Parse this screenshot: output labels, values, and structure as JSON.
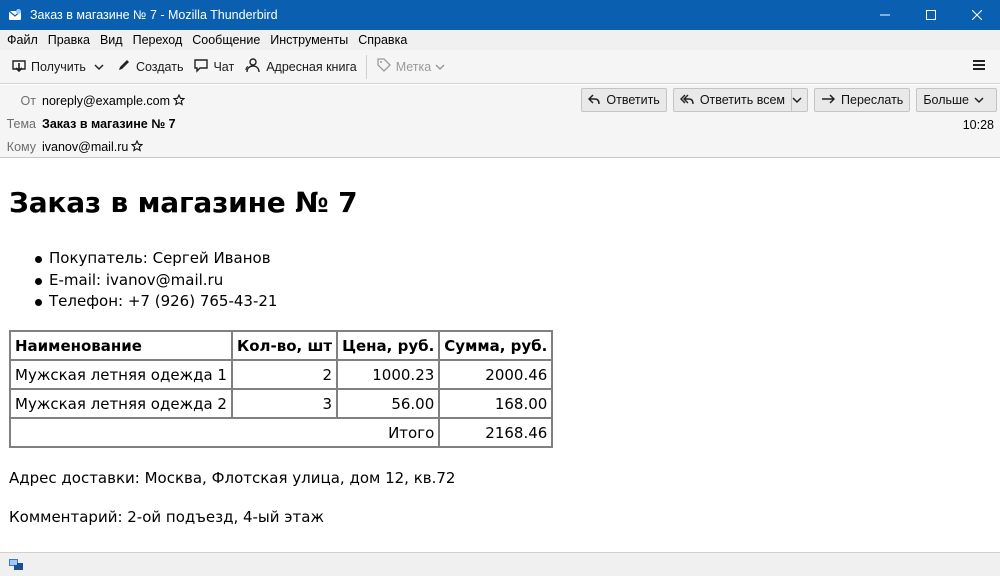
{
  "window": {
    "title": "Заказ в магазине № 7 - Mozilla Thunderbird",
    "controls": [
      "minimize-icon",
      "maximize-icon",
      "close-icon"
    ]
  },
  "menu": [
    "Файл",
    "Правка",
    "Вид",
    "Переход",
    "Сообщение",
    "Инструменты",
    "Справка"
  ],
  "toolbar": {
    "get_mail": "Получить",
    "write": "Создать",
    "chat": "Чат",
    "address_book": "Адресная книга",
    "tag": "Метка"
  },
  "headers": {
    "from_label": "От",
    "from_value": "noreply@example.com",
    "subject_label": "Тема",
    "subject_value": "Заказ в магазине № 7",
    "to_label": "Кому",
    "to_value": "ivanov@mail.ru",
    "time": "10:28",
    "reply": "Ответить",
    "reply_all": "Ответить всем",
    "forward": "Переслать",
    "more": "Больше"
  },
  "message": {
    "heading": "Заказ в магазине № 7",
    "customer": "Покупатель: Сергей Иванов",
    "email": "E-mail: ivanov@mail.ru",
    "phone": "Телефон: +7 (926) 765-43-21",
    "table": {
      "headers": [
        "Наименование",
        "Кол-во, шт",
        "Цена, руб.",
        "Сумма, руб."
      ],
      "rows": [
        [
          "Мужская летняя одежда 1",
          "2",
          "1000.23",
          "2000.46"
        ],
        [
          "Мужская летняя одежда 2",
          "3",
          "56.00",
          "168.00"
        ]
      ],
      "total_label": "Итого",
      "total_value": "2168.46"
    },
    "address": "Адрес доставки: Москва, Флотская улица, дом 12, кв.72",
    "comment": "Комментарий: 2-ой подъезд, 4-ый этаж"
  },
  "colors": {
    "titlebar": "#0b5fb0",
    "toolbar_bg": "#f5f5f5",
    "header_label": "#6e6e6e"
  }
}
